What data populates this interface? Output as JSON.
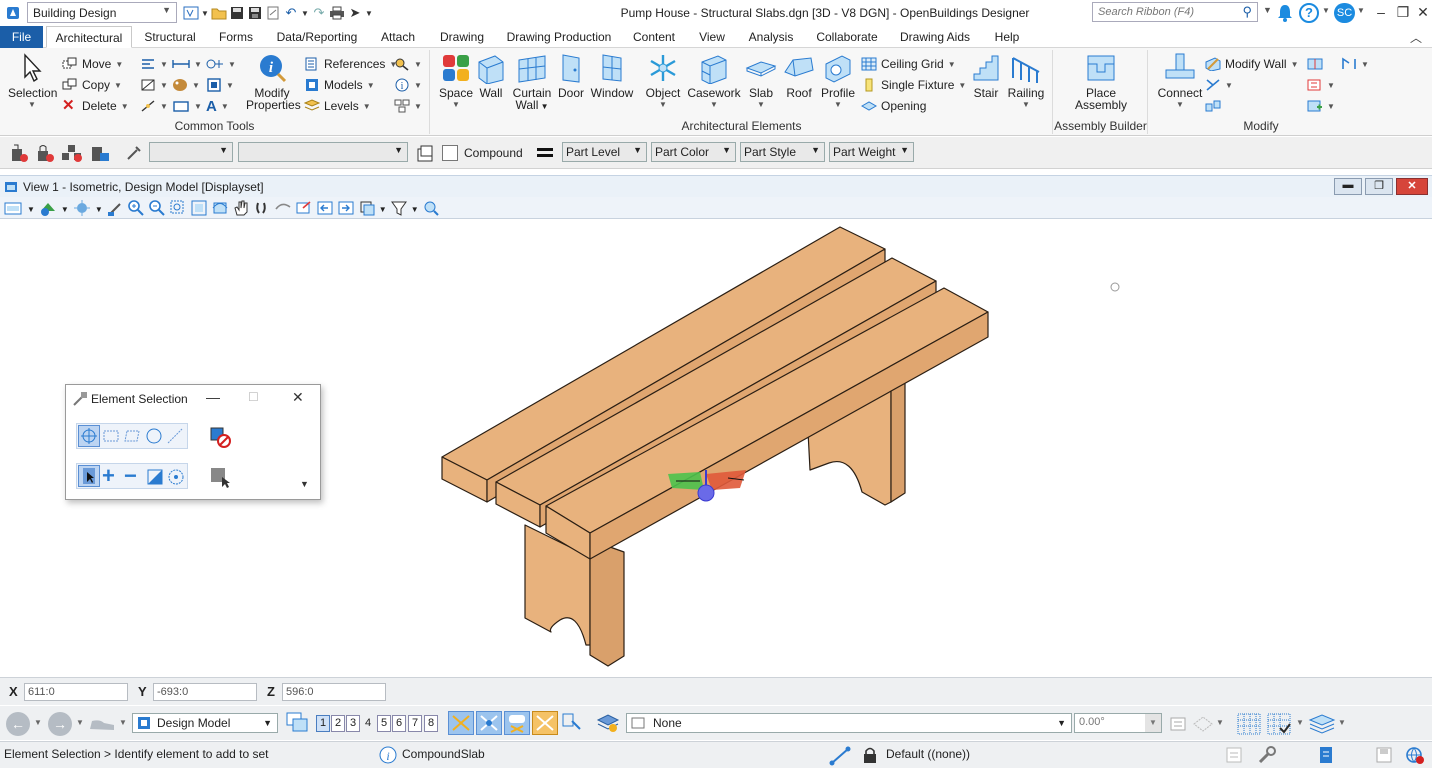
{
  "window": {
    "title": "Pump House - Structural Slabs.dgn [3D - V8 DGN] - OpenBuildings Designer",
    "workflow": "Building Design",
    "search_placeholder": "Search Ribbon (F4)",
    "user_initials": "SC"
  },
  "tabs": [
    "File",
    "Architectural",
    "Structural",
    "Forms",
    "Data/Reporting",
    "Attach",
    "Drawing",
    "Drawing Production",
    "Content",
    "View",
    "Analysis",
    "Collaborate",
    "Drawing Aids",
    "Help"
  ],
  "active_tab": "Architectural",
  "ribbon": {
    "common_tools": {
      "label": "Common Tools",
      "selection": "Selection",
      "move": "Move",
      "copy": "Copy",
      "delete": "Delete",
      "modify_properties": [
        "Modify",
        "Properties"
      ],
      "references": "References",
      "models": "Models",
      "levels": "Levels"
    },
    "architectural_elements": {
      "label": "Architectural Elements",
      "space": "Space",
      "wall": "Wall",
      "curtain_wall": [
        "Curtain",
        "Wall"
      ],
      "door": "Door",
      "window": "Window",
      "object": "Object",
      "casework": "Casework",
      "slab": "Slab",
      "roof": "Roof",
      "profile": "Profile",
      "ceiling_grid": "Ceiling Grid",
      "single_fixture": "Single Fixture",
      "opening": "Opening",
      "stair": "Stair",
      "railing": "Railing"
    },
    "assembly_builder": {
      "label": "Assembly Builder",
      "place_assembly": [
        "Place",
        "Assembly"
      ]
    },
    "modify": {
      "label": "Modify",
      "connect": "Connect",
      "modify_wall": "Modify Wall"
    }
  },
  "attribute_bar": {
    "compound": "Compound",
    "part_level": "Part Level",
    "part_color": "Part Color",
    "part_style": "Part Style",
    "part_weight": "Part Weight"
  },
  "view": {
    "title": "View 1 - Isometric, Design Model [Displayset]"
  },
  "element_selection": {
    "title": "Element Selection"
  },
  "coordinates": {
    "x_label": "X",
    "x": "611:0",
    "y_label": "Y",
    "y": "-693:0",
    "z_label": "Z",
    "z": "596:0"
  },
  "navigation": {
    "model": "Design Model",
    "views": [
      "1",
      "2",
      "3",
      "4",
      "5",
      "6",
      "7",
      "8"
    ],
    "active_view": "1",
    "snap_target": "None",
    "angle": "0.00°"
  },
  "status": {
    "prompt": "Element Selection > Identify element to add to set",
    "element_type": "CompoundSlab",
    "level": "Default ((none))"
  },
  "colors": {
    "accent": "#1b5ea8",
    "wood": "#e8b27d",
    "wood_edge": "#2b1f14"
  }
}
